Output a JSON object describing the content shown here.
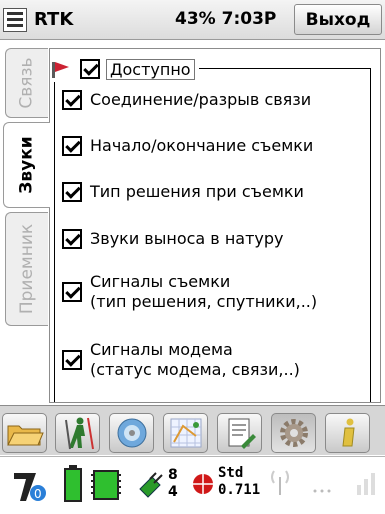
{
  "header": {
    "title": "RTK",
    "status": "43% 7:03P",
    "exit_label": "Выход"
  },
  "tabs": [
    {
      "label": "Связь",
      "active": false
    },
    {
      "label": "Звуки",
      "active": true
    },
    {
      "label": "Приемник",
      "active": false
    }
  ],
  "group": {
    "icon": "flag-icon",
    "enabled_label": "Доступно",
    "enabled": true
  },
  "options": [
    {
      "lines": [
        "Соединение/разрыв связи"
      ],
      "checked": true
    },
    {
      "lines": [
        "Начало/окончание съемки"
      ],
      "checked": true
    },
    {
      "lines": [
        "Тип решения при съемки"
      ],
      "checked": true
    },
    {
      "lines": [
        "Звуки выноса в натуру"
      ],
      "checked": true
    },
    {
      "lines": [
        "Сигналы съемки",
        "(тип решения, спутники,..)"
      ],
      "checked": true
    },
    {
      "lines": [
        "Сигналы модема",
        "(статус модема, связи,..)"
      ],
      "checked": true
    }
  ],
  "toolbar": {
    "buttons": [
      "folder-icon",
      "survey-person-icon",
      "disc-icon",
      "grid-map-icon",
      "document-icon",
      "gear-icon",
      "info-icon"
    ]
  },
  "statusbar": {
    "sats_used": "8",
    "sats_other": "4",
    "solution": "Std",
    "precision": "0.711",
    "instrument_badge": "0",
    "colors": {
      "battery": "#2fbf2f",
      "solution_dot": "#d01818"
    }
  }
}
